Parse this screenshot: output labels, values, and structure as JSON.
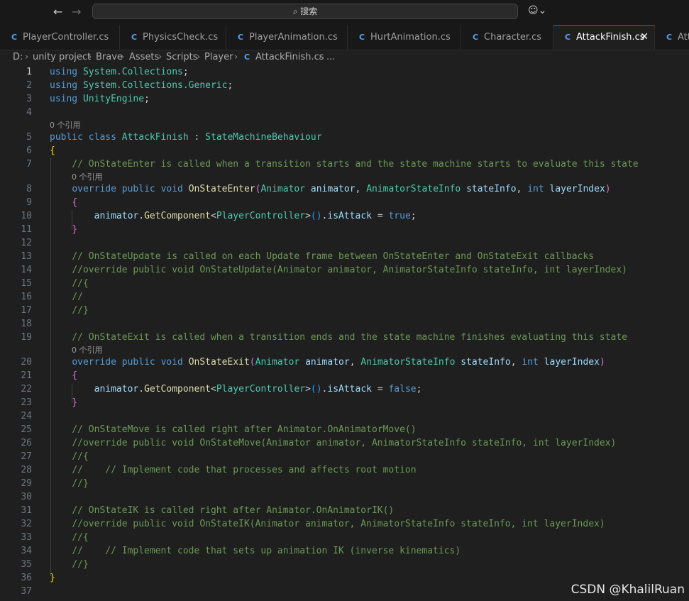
{
  "titlebar": {
    "search_placeholder": "搜索",
    "back_glyph": "←",
    "forward_glyph": "→",
    "search_glyph": "⌕",
    "copilot_glyph": "☺⌄"
  },
  "tabs": [
    {
      "label": "PlayerController.cs",
      "active": false
    },
    {
      "label": "PhysicsCheck.cs",
      "active": false
    },
    {
      "label": "PlayerAnimation.cs",
      "active": false
    },
    {
      "label": "HurtAnimation.cs",
      "active": false
    },
    {
      "label": "Character.cs",
      "active": false
    },
    {
      "label": "AttackFinish.cs",
      "active": true
    },
    {
      "label": "Att",
      "active": false
    }
  ],
  "tab_close_glyph": "✕",
  "tab_icon_glyph": "C",
  "breadcrumb": [
    "D:",
    "unity project",
    "Brave",
    "Assets",
    "Scripts",
    "Player",
    "AttackFinish.cs",
    "..."
  ],
  "breadcrumb_sep": "›",
  "code_lens": "0 个引用",
  "line_numbers": [
    "1",
    "2",
    "3",
    "4",
    "5",
    "6",
    "7",
    "8",
    "9",
    "10",
    "11",
    "12",
    "13",
    "14",
    "15",
    "16",
    "17",
    "18",
    "19",
    "20",
    "21",
    "22",
    "23",
    "24",
    "25",
    "26",
    "27",
    "28",
    "29",
    "30",
    "31",
    "32",
    "33",
    "34",
    "35",
    "36",
    "37"
  ],
  "code": {
    "using_kw": "using",
    "ns1": "System.Collections",
    "ns2": "System.Collections.Generic",
    "ns3": "UnityEngine",
    "semi": ";",
    "public_kw": "public",
    "class_kw": "class",
    "class_name": "AttackFinish",
    "colon": ":",
    "base_class": "StateMachineBehaviour",
    "lbrace": "{",
    "rbrace": "}",
    "c7": "// OnStateEnter is called when a transition starts and the state machine starts to evaluate this state",
    "override_kw": "override",
    "void_kw": "void",
    "m_enter": "OnStateEnter",
    "lparen": "(",
    "rparen": ")",
    "animator_type": "Animator",
    "animator_param": "animator",
    "comma": ",",
    "asi_type": "AnimatorStateInfo",
    "asi_param": "stateInfo",
    "int_kw": "int",
    "layer_param": "layerIndex",
    "get_component": "GetComponent",
    "lt": "<",
    "gt": ">",
    "pc_type": "PlayerController",
    "call_parens": "()",
    "dot": ".",
    "is_attack": "isAttack",
    "eq": "=",
    "true_kw": "true",
    "false_kw": "false",
    "c13": "// OnStateUpdate is called on each Update frame between OnStateEnter and OnStateExit callbacks",
    "c14": "//override public void OnStateUpdate(Animator animator, AnimatorStateInfo stateInfo, int layerIndex)",
    "c15": "//{",
    "c16": "//",
    "c17": "//}",
    "c19": "// OnStateExit is called when a transition ends and the state machine finishes evaluating this state",
    "m_exit": "OnStateExit",
    "c25": "// OnStateMove is called right after Animator.OnAnimatorMove()",
    "c26": "//override public void OnStateMove(Animator animator, AnimatorStateInfo stateInfo, int layerIndex)",
    "c27": "//{",
    "c28": "//    // Implement code that processes and affects root motion",
    "c29": "//}",
    "c31": "// OnStateIK is called right after Animator.OnAnimatorIK()",
    "c32": "//override public void OnStateIK(Animator animator, AnimatorStateInfo stateInfo, int layerIndex)",
    "c33": "//{",
    "c34": "//    // Implement code that sets up animation IK (inverse kinematics)",
    "c35": "//}"
  },
  "watermark": "CSDN @KhalilRuan",
  "colors": {
    "background": "#1f1f1f",
    "keyword": "#569cd6",
    "type": "#4ec9b0",
    "method": "#dcdcaa",
    "parameter": "#9cdcfe",
    "comment": "#6a9955",
    "accent": "#0078d4"
  }
}
